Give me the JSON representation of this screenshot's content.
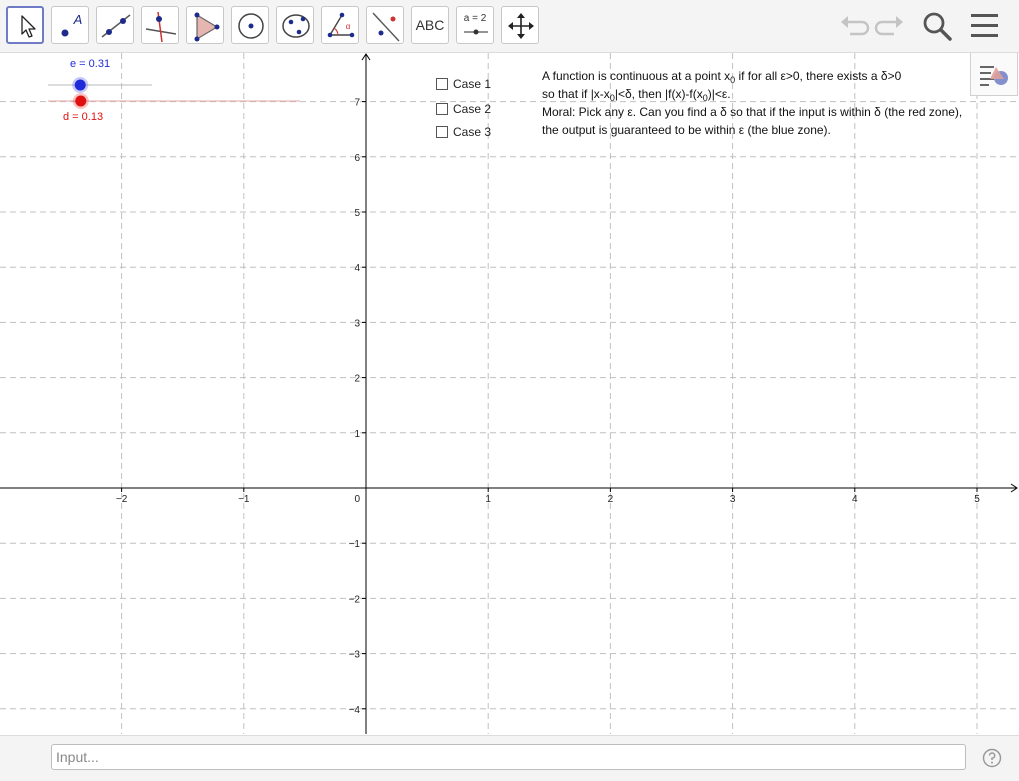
{
  "toolbar": {
    "tools": [
      {
        "name": "move-tool",
        "text": ""
      },
      {
        "name": "point-tool",
        "text": "A"
      },
      {
        "name": "line-tool",
        "text": ""
      },
      {
        "name": "perpendicular-line-tool",
        "text": ""
      },
      {
        "name": "polygon-tool",
        "text": ""
      },
      {
        "name": "circle-tool",
        "text": ""
      },
      {
        "name": "conic-tool",
        "text": ""
      },
      {
        "name": "angle-tool",
        "text": "α"
      },
      {
        "name": "reflect-tool",
        "text": ""
      },
      {
        "name": "text-tool",
        "text": "ABC"
      },
      {
        "name": "slider-tool",
        "text": "a = 2"
      },
      {
        "name": "move-graphics-view-tool",
        "text": ""
      }
    ],
    "selected": "move-tool",
    "right_buttons": [
      "undo-icon",
      "redo-icon",
      "search-icon",
      "menu-icon"
    ]
  },
  "sliders": {
    "epsilon": {
      "label": "e = 0.31",
      "value": 0.31,
      "color": "#1f2bd9"
    },
    "delta": {
      "label": "d = 0.13",
      "value": 0.13,
      "color": "#e01010"
    }
  },
  "checkboxes": [
    {
      "label": "Case 1",
      "checked": false
    },
    {
      "label": "Case 2",
      "checked": false
    },
    {
      "label": "Case 3",
      "checked": false
    }
  ],
  "description": {
    "line1_a": "A function is continuous at a point x",
    "line1_sub": "0",
    "line1_b": " if for all ε>0, there exists a δ>0",
    "line2_a": "so that if |x-x",
    "line2_sub1": "0",
    "line2_b": "|<δ, then |f(x)-f(x",
    "line2_sub2": "0",
    "line2_c": ")|<ε.",
    "line3": "Moral: Pick any ε. Can you find a δ so that if the input is within δ (the red zone),",
    "line4": "the output is guaranteed to be within ε (the blue zone)."
  },
  "axes": {
    "x_ticks": [
      {
        "value": -2,
        "label": "−2"
      },
      {
        "value": -1,
        "label": "−1"
      },
      {
        "value": 1,
        "label": "1"
      },
      {
        "value": 2,
        "label": "2"
      },
      {
        "value": 3,
        "label": "3"
      },
      {
        "value": 4,
        "label": "4"
      },
      {
        "value": 5,
        "label": "5"
      }
    ],
    "y_ticks": [
      {
        "value": 7,
        "label": "7"
      },
      {
        "value": 6,
        "label": "6"
      },
      {
        "value": 5,
        "label": "5"
      },
      {
        "value": 4,
        "label": "4"
      },
      {
        "value": 3,
        "label": "3"
      },
      {
        "value": 2,
        "label": "2"
      },
      {
        "value": 1,
        "label": "1"
      },
      {
        "value": -1,
        "label": "−1"
      },
      {
        "value": -2,
        "label": "−2"
      },
      {
        "value": -3,
        "label": "−3"
      },
      {
        "value": -4,
        "label": "−4"
      }
    ],
    "origin_label": "0",
    "x_range": [
      -3,
      5.3
    ],
    "y_range": [
      -4.4,
      7.8
    ],
    "grid": true
  },
  "input_bar": {
    "placeholder": "Input...",
    "value": ""
  },
  "colors": {
    "grid": "#c0c0c0",
    "axis": "#000000",
    "epsilon": "#1f2bd9",
    "delta": "#e01010",
    "selected_tool": "#6f7cc5"
  }
}
